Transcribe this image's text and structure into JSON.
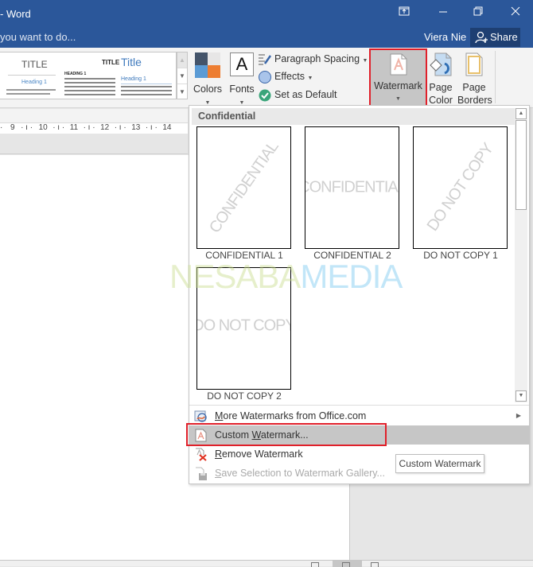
{
  "window": {
    "title": "- Word",
    "tell_me": "you want to do...",
    "user_name": "Viera Nie",
    "share_label": "Share",
    "controls": [
      "ribbon-display-options",
      "minimize",
      "restore",
      "close"
    ]
  },
  "ribbon": {
    "styles_gallery": {
      "thumbs": [
        {
          "title": "TITLE",
          "heading": "Heading 1"
        },
        {
          "title": "TITLE",
          "heading": "HEADING 1"
        },
        {
          "title": "Title",
          "heading": "Heading 1"
        }
      ]
    },
    "colors_label": "Colors",
    "fonts_label": "Fonts",
    "fonts_glyph": "A",
    "paragraph_spacing_label": "Paragraph Spacing",
    "effects_label": "Effects",
    "set_default_label": "Set as Default",
    "watermark_label": "Watermark",
    "page_color_label_1": "Page",
    "page_color_label_2": "Color",
    "page_borders_label_1": "Page",
    "page_borders_label_2": "Borders"
  },
  "ruler": {
    "ticks": [
      "9",
      "10",
      "11",
      "12",
      "13",
      "14"
    ]
  },
  "watermark_menu": {
    "section_title": "Confidential",
    "items": [
      {
        "caption": "CONFIDENTIAL 1",
        "text": "CONFIDENTIAL",
        "style": "diagonal"
      },
      {
        "caption": "CONFIDENTIAL 2",
        "text": "CONFIDENTIAL",
        "style": "horizontal"
      },
      {
        "caption": "DO NOT COPY 1",
        "text": "DO NOT COPY",
        "style": "diagonal"
      },
      {
        "caption": "DO NOT COPY 2",
        "text": "DO NOT COPY",
        "style": "horizontal"
      }
    ],
    "commands": [
      {
        "pre": "",
        "key": "M",
        "post": "ore Watermarks from Office.com",
        "submenu": true,
        "enabled": true
      },
      {
        "pre": "Custom ",
        "key": "W",
        "post": "atermark...",
        "submenu": false,
        "enabled": true,
        "highlighted": true
      },
      {
        "pre": "",
        "key": "R",
        "post": "emove Watermark",
        "submenu": false,
        "enabled": true
      },
      {
        "pre": "",
        "key": "S",
        "post": "ave Selection to Watermark Gallery...",
        "submenu": false,
        "enabled": false
      }
    ],
    "tooltip": "Custom Watermark"
  },
  "overlay_logo": {
    "part1": "NESABA",
    "part2": "MEDIA"
  },
  "colors": {
    "titlebar": "#2b579a",
    "share_button": "#1e3f72",
    "highlight_border": "#e0202a",
    "hover": "#c6c6c6",
    "theme_swatches": [
      "#44546a",
      "#e7e6e6",
      "#5b9bd5",
      "#ed7d31"
    ]
  }
}
